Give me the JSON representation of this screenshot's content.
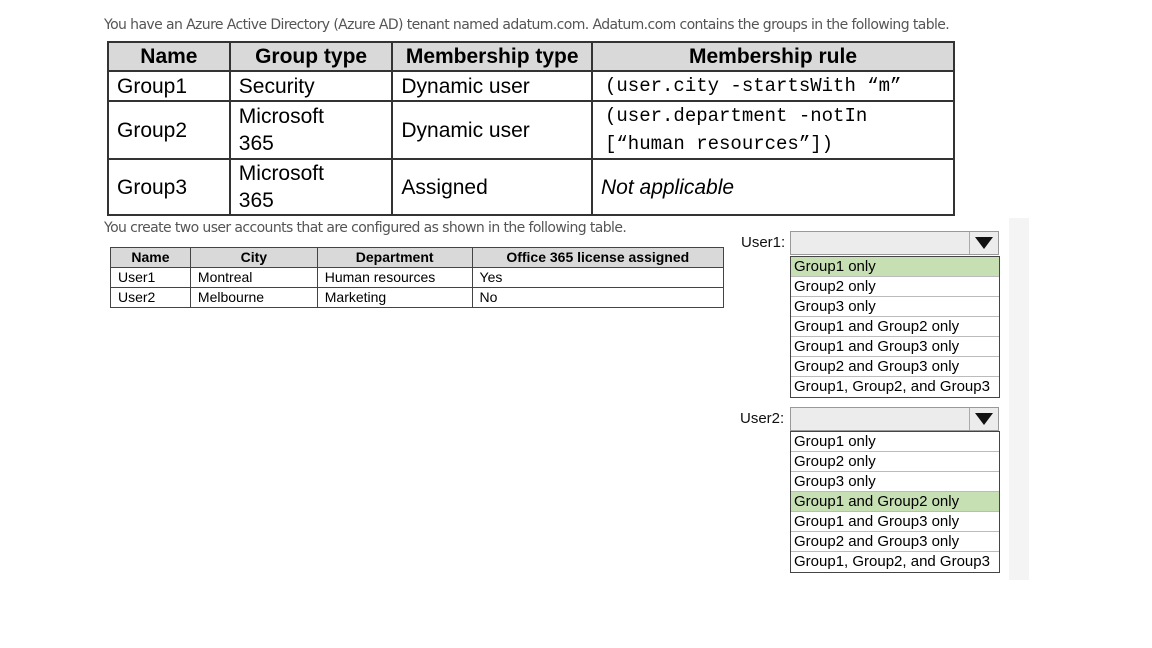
{
  "intro1": "You have an Azure Active Directory (Azure AD) tenant named adatum.com. Adatum.com contains the groups in the following table.",
  "groups_table": {
    "headers": [
      "Name",
      "Group type",
      "Membership type",
      "Membership rule"
    ],
    "rows": [
      {
        "name": "Group1",
        "type": "Security",
        "membership": "Dynamic user",
        "rule": "(user.city -startsWith “m”",
        "rule2": ""
      },
      {
        "name": "Group2",
        "type": "Microsoft",
        "type2": "365",
        "membership": "Dynamic user",
        "rule": "(user.department -notIn",
        "rule2": "[“human resources”])"
      },
      {
        "name": "Group3",
        "type": "Microsoft",
        "type2": "365",
        "membership": "Assigned",
        "rule": "Not applicable"
      }
    ]
  },
  "intro2": "You create two user accounts that are configured as shown in the following table.",
  "users_table": {
    "headers": [
      "Name",
      "City",
      "Department",
      "Office 365 license assigned"
    ],
    "rows": [
      {
        "name": "User1",
        "city": "Montreal",
        "department": "Human resources",
        "license": "Yes"
      },
      {
        "name": "User2",
        "city": "Melbourne",
        "department": "Marketing",
        "license": "No"
      }
    ]
  },
  "answers": {
    "user1": {
      "label": "User1:",
      "options": [
        "Group1 only",
        "Group2 only",
        "Group3 only",
        "Group1 and Group2 only",
        "Group1 and Group3 only",
        "Group2 and Group3 only",
        "Group1, Group2, and Group3"
      ],
      "selected_index": 0
    },
    "user2": {
      "label": "User2:",
      "options": [
        "Group1 only",
        "Group2 only",
        "Group3 only",
        "Group1 and Group2 only",
        "Group1 and Group3 only",
        "Group2 and Group3 only",
        "Group1, Group2, and Group3"
      ],
      "selected_index": 3
    }
  },
  "colors": {
    "selected": "#c6e0b4",
    "header_bg": "#d9d9d9"
  },
  "icons": {
    "dropdown": "chevron-down-icon"
  }
}
